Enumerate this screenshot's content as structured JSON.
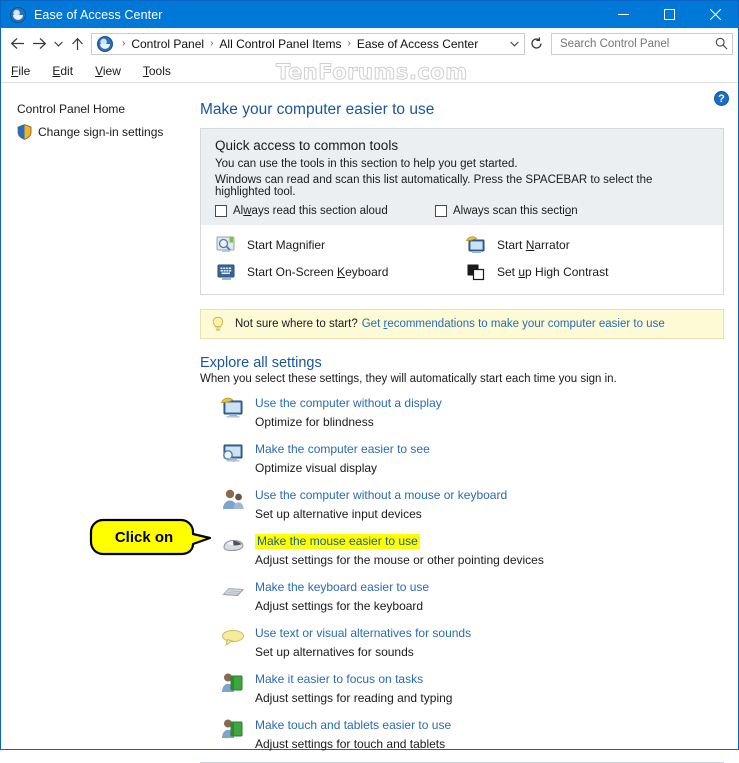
{
  "window": {
    "title": "Ease of Access Center",
    "title_icon": "ease-of-access-icon",
    "minimize_label": "─",
    "maximize_label": "□",
    "close_label": "✕",
    "accent_color": "#0078d7"
  },
  "address_bar": {
    "back_icon": "back-arrow-icon",
    "forward_icon": "forward-arrow-icon",
    "recent_icon": "chevron-down-icon",
    "up_icon": "up-arrow-icon",
    "breadcrumb": [
      "Control Panel",
      "All Control Panel Items",
      "Ease of Access Center"
    ],
    "separator": "›",
    "dropdown_icon": "chevron-down-icon",
    "refresh_icon": "refresh-icon",
    "refresh_label": "↻"
  },
  "search": {
    "placeholder": "Search Control Panel",
    "value": "",
    "icon": "search-icon"
  },
  "menu": {
    "items": [
      {
        "pre": "",
        "accel": "F",
        "post": "ile"
      },
      {
        "pre": "",
        "accel": "E",
        "post": "dit"
      },
      {
        "pre": "",
        "accel": "V",
        "post": "iew"
      },
      {
        "pre": "",
        "accel": "T",
        "post": "ools"
      }
    ]
  },
  "watermark": "TenForums.com",
  "sidebar": {
    "items": [
      {
        "label": "Control Panel Home",
        "icon": null
      },
      {
        "label": "Change sign-in settings",
        "icon": "shield-icon"
      }
    ]
  },
  "help": {
    "label": "?",
    "icon": "help-icon"
  },
  "main": {
    "page_title": "Make your computer easier to use",
    "quick_access": {
      "title": "Quick access to common tools",
      "line1": "You can use the tools in this section to help you get started.",
      "line2": "Windows can read and scan this list automatically.  Press the SPACEBAR to select the highlighted tool.",
      "checkboxes": [
        {
          "pre": "Al",
          "accel": "w",
          "post": "ays read this section aloud",
          "checked": false
        },
        {
          "pre": "Always scan this secti",
          "accel": "o",
          "post": "n",
          "checked": false
        }
      ],
      "tools": [
        {
          "pre": "Start Magnifier",
          "accel": "",
          "post": "",
          "icon": "magnifier-icon"
        },
        {
          "pre": "Start ",
          "accel": "N",
          "post": "arrator",
          "icon": "narrator-icon"
        },
        {
          "pre": "Start On-Screen ",
          "accel": "K",
          "post": "eyboard",
          "icon": "onscreen-keyboard-icon"
        },
        {
          "pre": "Set ",
          "accel": "u",
          "post": "p High Contrast",
          "icon": "high-contrast-icon"
        }
      ]
    },
    "tip": {
      "icon": "lightbulb-icon",
      "question": "Not sure where to start?",
      "link_pre": "Get ",
      "link_accel": "r",
      "link_post": "ecommendations to make your computer easier to use"
    },
    "explore": {
      "title": "Explore all settings",
      "subtitle": "When you select these settings, they will automatically start each time you sign in.",
      "items": [
        {
          "link": "Use the computer without a display",
          "desc": "Optimize for blindness",
          "icon": "display-speech-icon",
          "highlighted": false
        },
        {
          "link": "Make the computer easier to see",
          "desc": "Optimize visual display",
          "icon": "display-magnify-icon",
          "highlighted": false
        },
        {
          "link": "Use the computer without a mouse or keyboard",
          "desc": "Set up alternative input devices",
          "icon": "person-input-icon",
          "highlighted": false
        },
        {
          "link": "Make the mouse easier to use",
          "desc": "Adjust settings for the mouse or other pointing devices",
          "icon": "mouse-icon",
          "highlighted": true
        },
        {
          "link": "Make the keyboard easier to use",
          "desc": "Adjust settings for the keyboard",
          "icon": "keyboard-icon",
          "highlighted": false
        },
        {
          "link": "Use text or visual alternatives for sounds",
          "desc": "Set up alternatives for sounds",
          "icon": "speech-bubble-icon",
          "highlighted": false
        },
        {
          "link": "Make it easier to focus on tasks",
          "desc": "Adjust settings for reading and typing",
          "icon": "person-book-icon",
          "highlighted": false
        },
        {
          "link": "Make touch and tablets easier to use",
          "desc": "Adjust settings for touch and tablets",
          "icon": "person-tablet-icon",
          "highlighted": false
        }
      ]
    }
  },
  "callout": {
    "text": "Click on",
    "fill_color": "#ffff00",
    "border_color": "#000000"
  }
}
